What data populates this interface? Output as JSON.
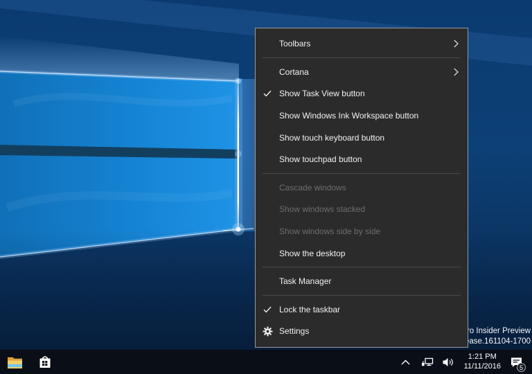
{
  "desktop": {
    "watermark_line1": "ro Insider Preview",
    "watermark_line2": "ease.161104-1700"
  },
  "context_menu": {
    "items": [
      {
        "label": "Toolbars",
        "state": "submenu"
      },
      {
        "label": "Cortana",
        "state": "submenu"
      },
      {
        "label": "Show Task View button",
        "state": "checked"
      },
      {
        "label": "Show Windows Ink Workspace button",
        "state": "normal"
      },
      {
        "label": "Show touch keyboard button",
        "state": "normal"
      },
      {
        "label": "Show touchpad button",
        "state": "normal"
      },
      {
        "label": "Cascade windows",
        "state": "disabled"
      },
      {
        "label": "Show windows stacked",
        "state": "disabled"
      },
      {
        "label": "Show windows side by side",
        "state": "disabled"
      },
      {
        "label": "Show the desktop",
        "state": "normal"
      },
      {
        "label": "Task Manager",
        "state": "normal"
      },
      {
        "label": "Lock the taskbar",
        "state": "checked"
      },
      {
        "label": "Settings",
        "state": "gear"
      }
    ]
  },
  "taskbar": {
    "clock": {
      "time": "1:21 PM",
      "date": "11/11/2016"
    },
    "notification_badge": "5",
    "icons": [
      "file-explorer-icon",
      "store-icon",
      "hidden-icons-chevron-icon",
      "network-icon",
      "volume-icon",
      "action-center-icon",
      "checkmark-icon",
      "gear-icon",
      "submenu-arrow-icon"
    ]
  },
  "colors": {
    "menu_bg": "#2b2b2b",
    "menu_border": "#9a9a9a",
    "menu_text": "#f2f2f2",
    "menu_disabled_text": "#6d6d6d",
    "separator": "#4a4a4a",
    "taskbar_bg": "#0a0e17",
    "wallpaper_pane_blue": "#1583d3",
    "wallpaper_dark_blue": "#0a3a70"
  }
}
